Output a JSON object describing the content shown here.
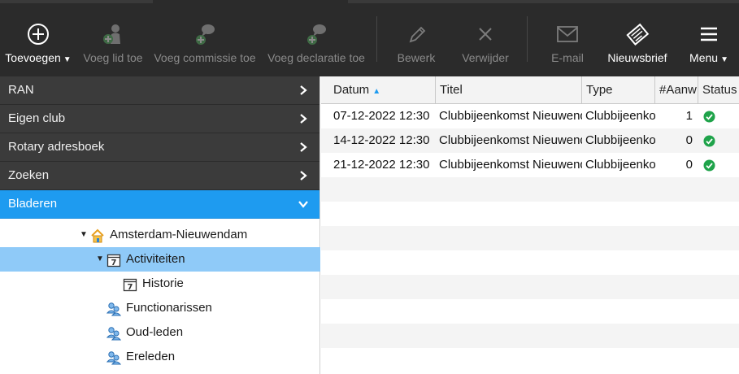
{
  "toolbar": {
    "add_label": "Toevoegen",
    "add_member_label": "Voeg lid toe",
    "add_committee_label": "Voeg commissie toe",
    "add_declaration_label": "Voeg declaratie toe",
    "edit_label": "Bewerk",
    "delete_label": "Verwijder",
    "email_label": "E-mail",
    "newsletter_label": "Nieuwsbrief",
    "menu_label": "Menu"
  },
  "sidebar": {
    "sections": [
      {
        "label": "RAN"
      },
      {
        "label": "Eigen club"
      },
      {
        "label": "Rotary adresboek"
      },
      {
        "label": "Zoeken"
      },
      {
        "label": "Bladeren"
      }
    ],
    "tree": {
      "club": "Amsterdam-Nieuwendam",
      "activities": "Activiteiten",
      "history": "Historie",
      "officers": "Functionarissen",
      "former_members": "Oud-leden",
      "honorary_members": "Ereleden"
    }
  },
  "grid": {
    "columns": [
      "Datum",
      "Titel",
      "Type",
      "#Aanw",
      "Status"
    ],
    "rows": [
      {
        "date": "07-12-2022 12:30",
        "title": "Clubbijeenkomst Nieuwendam",
        "type": "Clubbijeenkomst",
        "count": "1",
        "status": "ok"
      },
      {
        "date": "14-12-2022 12:30",
        "title": "Clubbijeenkomst Nieuwendam",
        "type": "Clubbijeenkomst",
        "count": "0",
        "status": "ok"
      },
      {
        "date": "21-12-2022 12:30",
        "title": "Clubbijeenkomst Nieuwendam",
        "type": "Clubbijeenkomst",
        "count": "0",
        "status": "ok"
      }
    ]
  },
  "colors": {
    "toolbar_bg": "#2b2b2b",
    "accordion_bg": "#3b3b3b",
    "accent": "#1e9bf0",
    "selected_row": "#8fcaf8",
    "status_ok": "#1fa34a"
  }
}
